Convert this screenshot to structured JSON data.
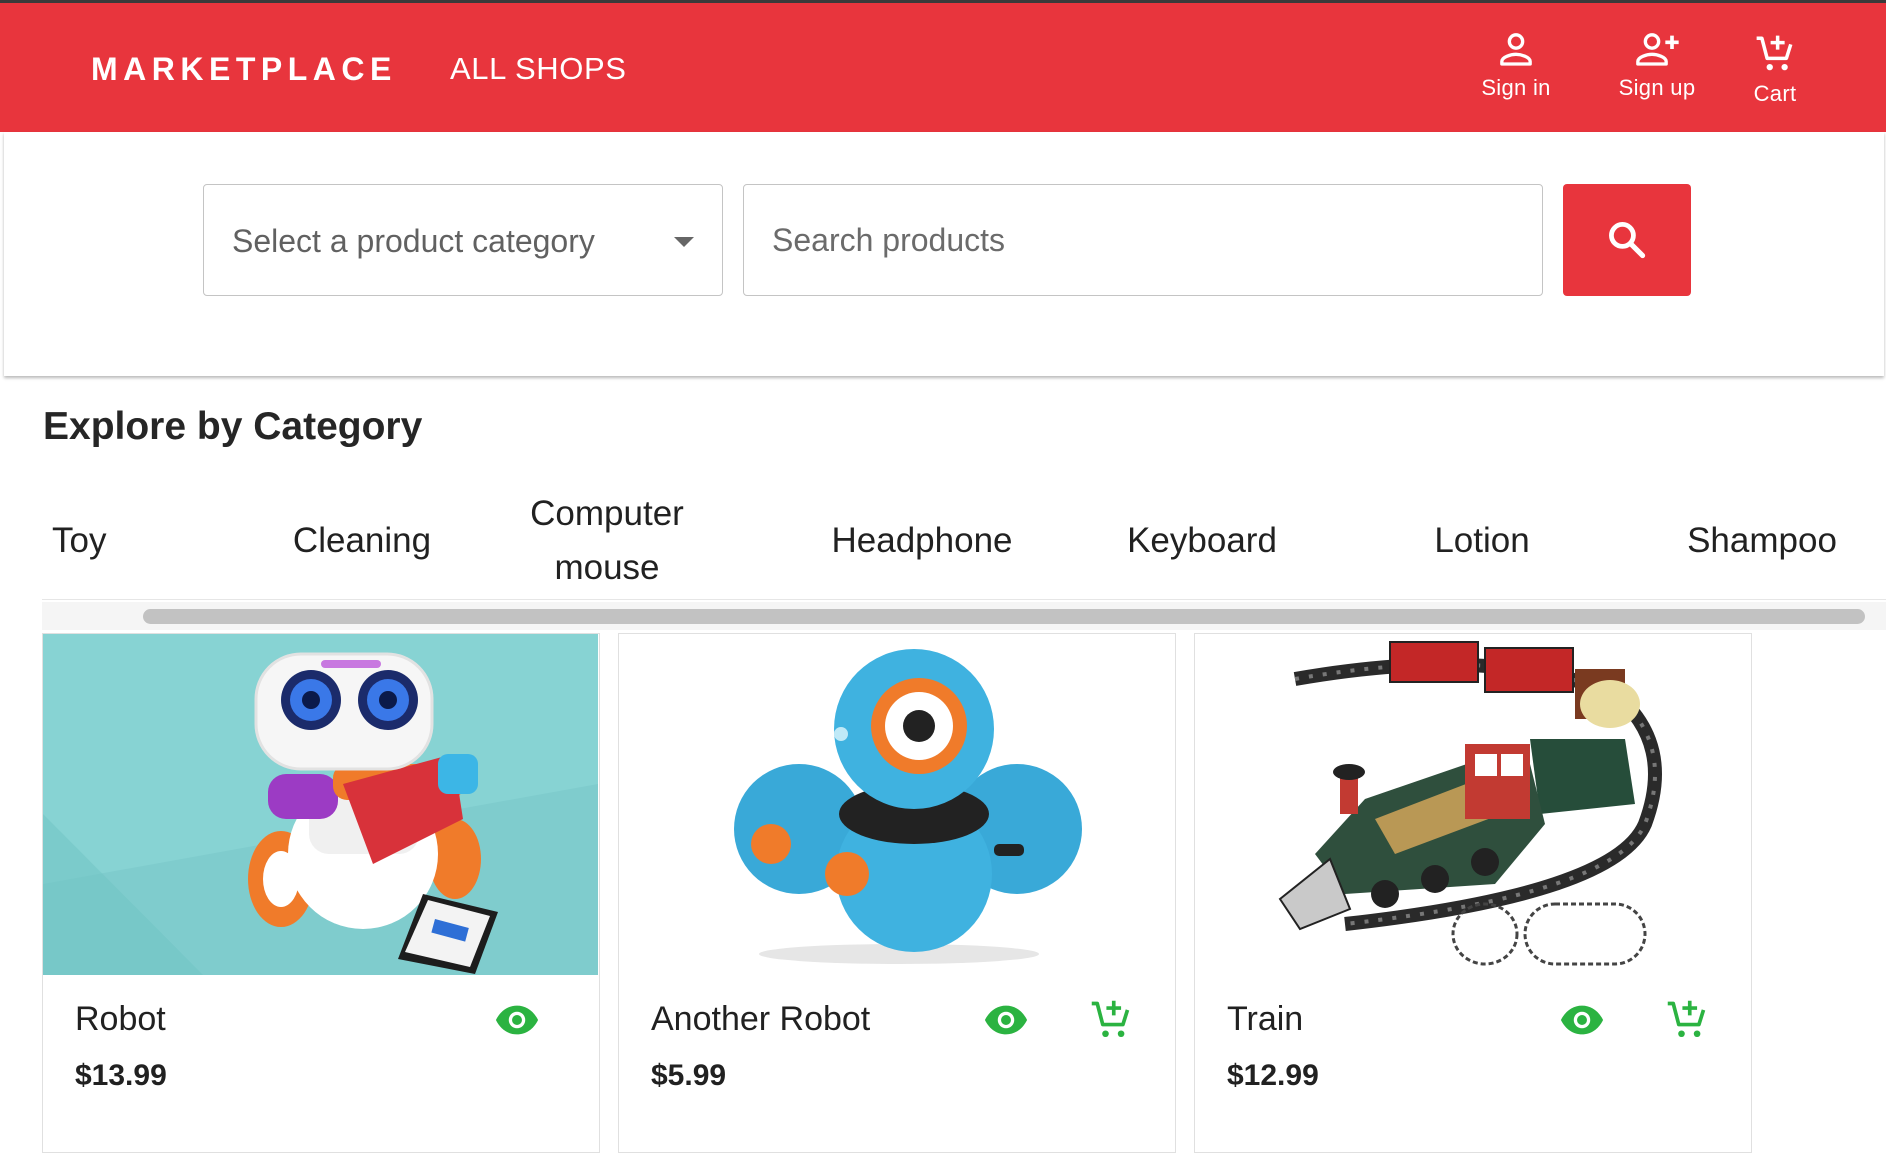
{
  "header": {
    "brand": "MARKETPLACE",
    "all_shops": "ALL SHOPS",
    "sign_in": "Sign in",
    "sign_up": "Sign up",
    "cart": "Cart",
    "background_color": "#e8353d"
  },
  "search": {
    "category_placeholder": "Select a product category",
    "search_placeholder": "Search products",
    "button_icon": "search-icon"
  },
  "categories": {
    "title": "Explore by Category",
    "items": [
      "Toy",
      "Cleaning",
      "Computer mouse",
      "Headphone",
      "Keyboard",
      "Lotion",
      "Shampoo"
    ]
  },
  "products": [
    {
      "name": "Robot",
      "price": "$13.99",
      "image": "robot-image"
    },
    {
      "name": "Another Robot",
      "price": "$5.99",
      "image": "blue-robot-image"
    },
    {
      "name": "Train",
      "price": "$12.99",
      "image": "train-image"
    }
  ],
  "colors": {
    "accent": "#e8353d",
    "action_green": "#2bb341"
  }
}
